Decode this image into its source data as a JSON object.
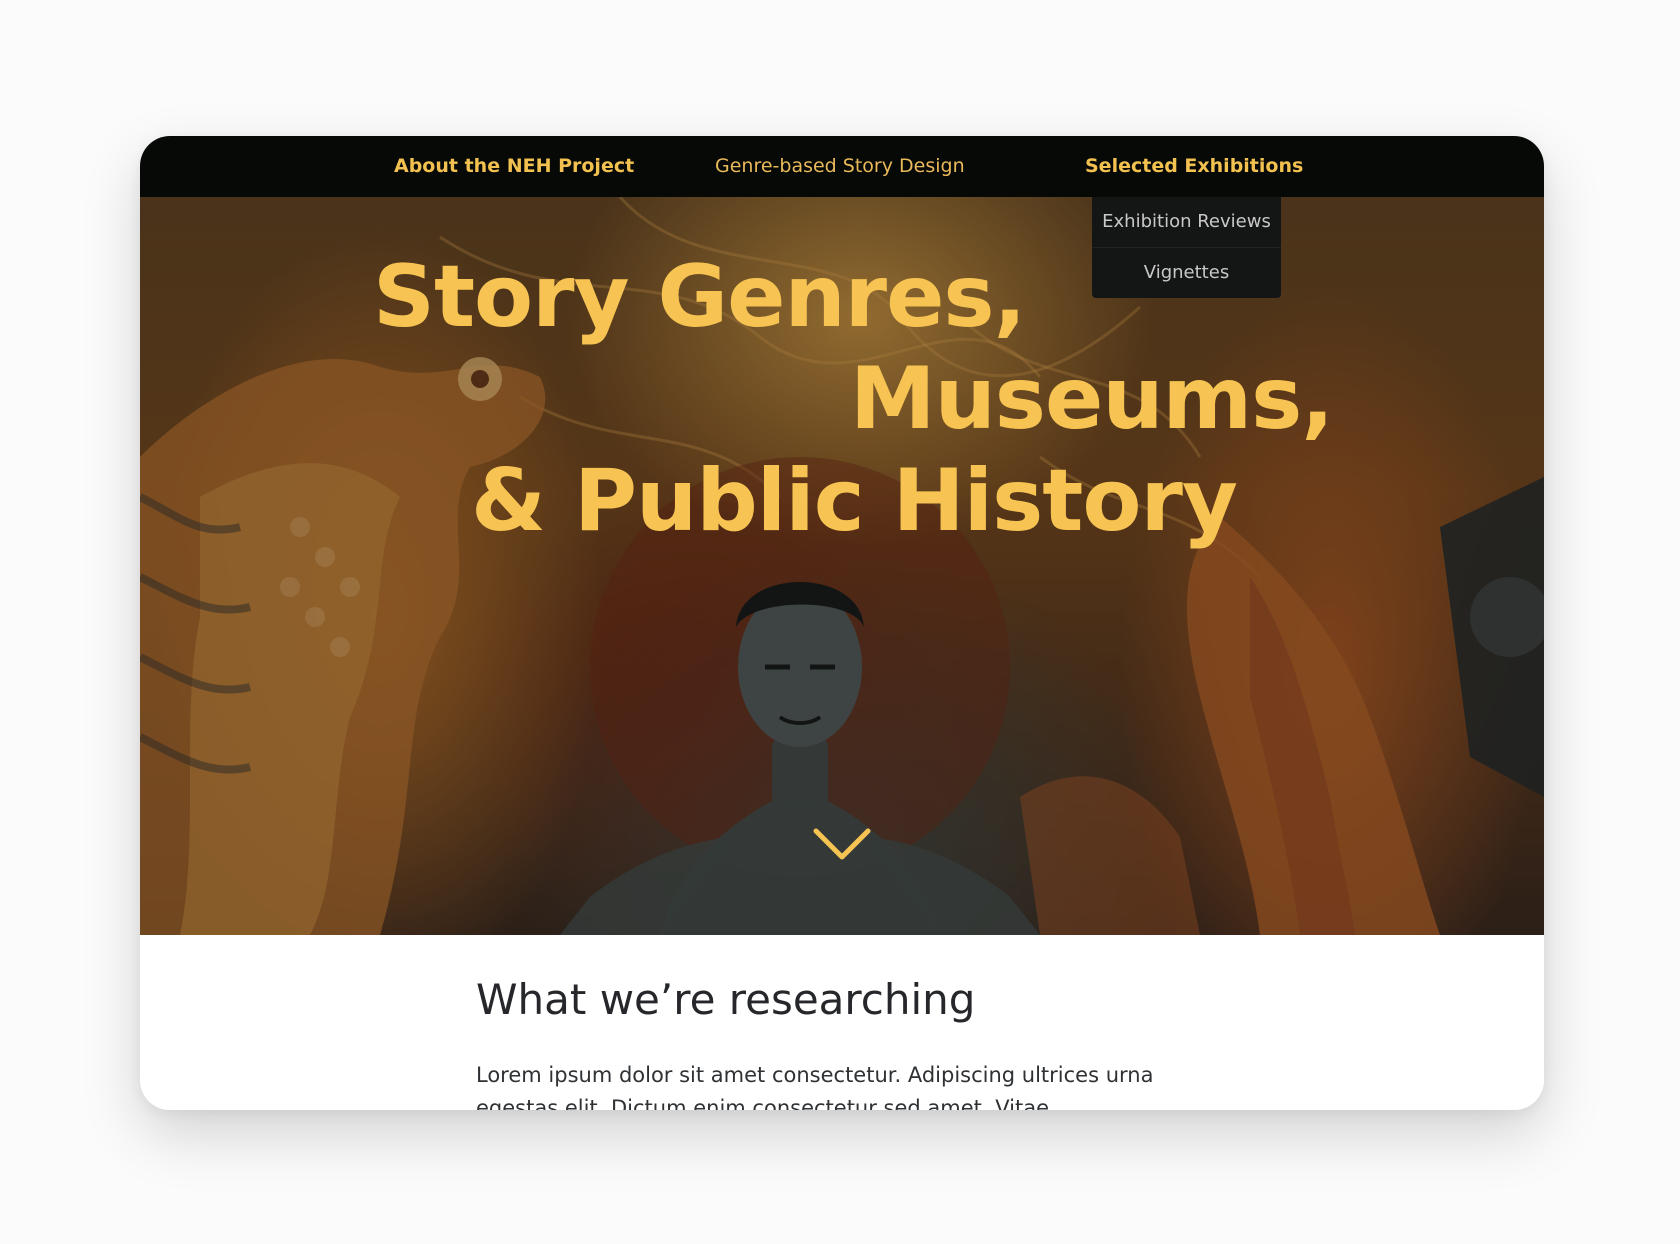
{
  "nav": {
    "items": [
      {
        "label": "About the NEH Project"
      },
      {
        "label": "Genre-based Story Design"
      },
      {
        "label": "Selected Exhibitions"
      }
    ],
    "dropdown": {
      "items": [
        {
          "label": "Exhibition Reviews"
        },
        {
          "label": "Vignettes"
        }
      ]
    }
  },
  "hero": {
    "lines": [
      "Story Genres,",
      "Museums,",
      "& Public History"
    ],
    "scroll_icon": "chevron-down-icon"
  },
  "section": {
    "title": "What we’re researching",
    "body": "Lorem ipsum dolor sit amet consectetur. Adipiscing ultrices urna egestas elit. Dictum enim consectetur sed amet. Vitae"
  },
  "colors": {
    "accent": "#f7c453",
    "nav_bg": "#060906",
    "dropdown_bg": "#141515",
    "heading_text": "#25272a"
  }
}
